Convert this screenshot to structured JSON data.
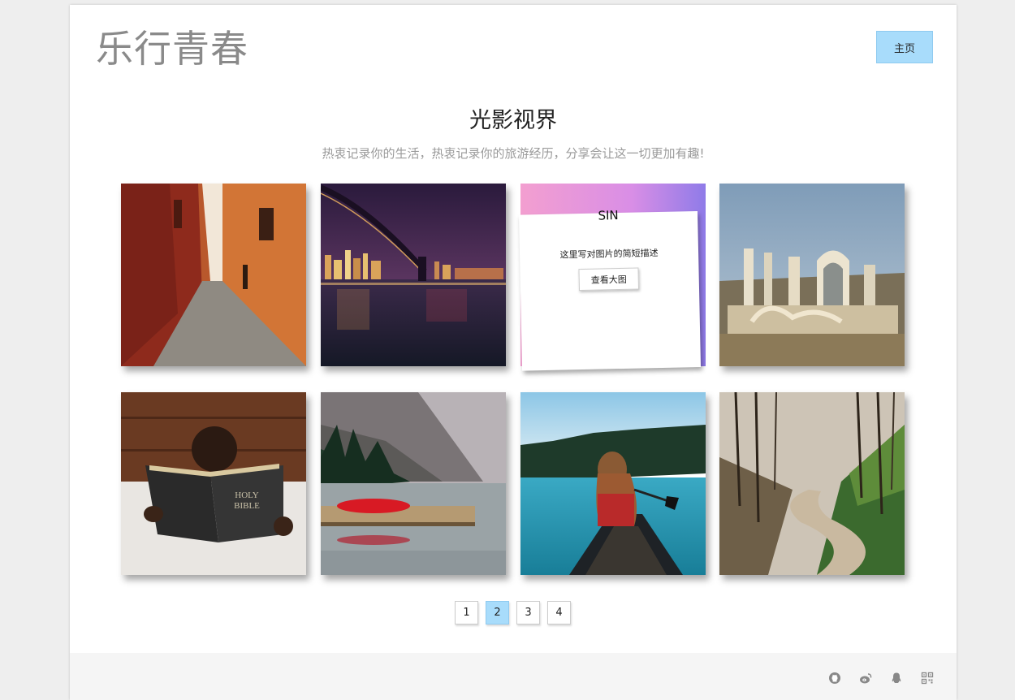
{
  "header": {
    "logo": "乐行青春",
    "home_label": "主页"
  },
  "section": {
    "title": "光影视界",
    "subtitle": "热衷记录你的生活，热衷记录你的旅游经历，分享会让这一切更加有趣!"
  },
  "gallery": {
    "hover_card": {
      "title": "SIN",
      "description": "这里写对图片的简短描述",
      "button_label": "查看大图"
    }
  },
  "pagination": {
    "pages": [
      "1",
      "2",
      "3",
      "4"
    ],
    "active": "2"
  },
  "footer": {
    "icons": [
      "github-icon",
      "weibo-icon",
      "qq-icon",
      "qrcode-icon"
    ]
  },
  "colors": {
    "accent": "#a8dcfb",
    "logo_text": "#8a8a8a",
    "subtitle_text": "#9a9a9a",
    "footer_bg": "#f5f5f5"
  }
}
